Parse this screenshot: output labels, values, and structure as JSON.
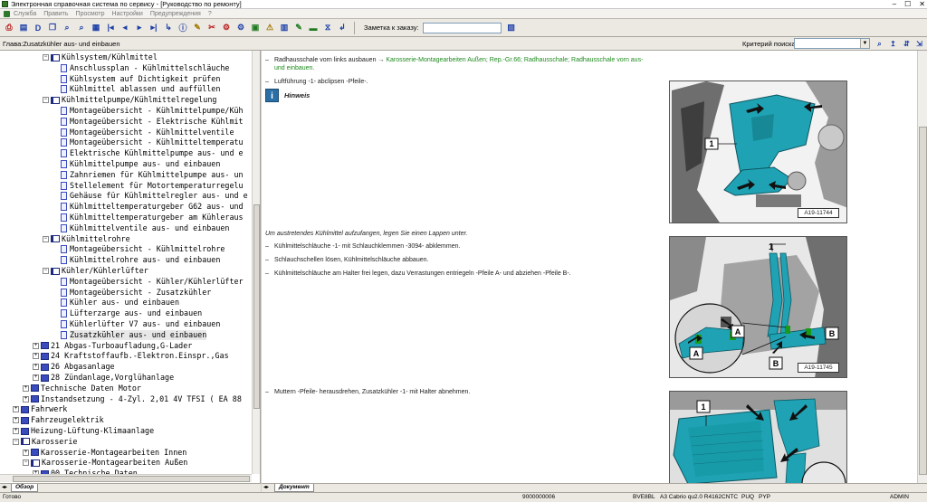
{
  "window": {
    "title": "Электронная справочная система по сервису - [Руководство по ремонту]",
    "controls": [
      "–",
      "☐",
      "✕"
    ]
  },
  "menu": [
    "Служба",
    "Править",
    "Просмотр",
    "Настройки",
    "Предупреждения",
    "?"
  ],
  "toolbar": {
    "buttons": [
      {
        "name": "print-button",
        "glyph": "⎙",
        "cls": "tb-red"
      },
      {
        "name": "open-button",
        "glyph": "▤",
        "cls": "tb-blue"
      },
      {
        "name": "document-button",
        "glyph": "D",
        "cls": "tb-blue"
      },
      {
        "name": "copy-button",
        "glyph": "❐",
        "cls": "tb-blue"
      },
      {
        "name": "find-button",
        "glyph": "⌕",
        "cls": "tb-blue"
      },
      {
        "name": "find-next-button",
        "glyph": "⌕",
        "cls": "tb-blue"
      },
      {
        "name": "notes-button",
        "glyph": "▦",
        "cls": "tb-blue"
      },
      {
        "name": "first-button",
        "glyph": "|◂",
        "cls": "tb-blue"
      },
      {
        "name": "prev-button",
        "glyph": "◂",
        "cls": "tb-blue"
      },
      {
        "name": "next-button",
        "glyph": "▸",
        "cls": "tb-blue"
      },
      {
        "name": "last-button",
        "glyph": "▸|",
        "cls": "tb-blue"
      },
      {
        "name": "bookmark-button",
        "glyph": "↳",
        "cls": "tb-blue"
      },
      {
        "name": "info-button",
        "glyph": "ⓘ",
        "cls": "tb-blue"
      },
      {
        "name": "settings-button",
        "glyph": "✎",
        "cls": "tb-yel"
      },
      {
        "name": "tools-button",
        "glyph": "✂",
        "cls": "tb-red"
      },
      {
        "name": "engine-button",
        "glyph": "⚙",
        "cls": "tb-red"
      },
      {
        "name": "gearbox-button",
        "glyph": "⚙",
        "cls": "tb-blue"
      },
      {
        "name": "body-button",
        "glyph": "▣",
        "cls": "tb-grn"
      },
      {
        "name": "warning-button",
        "glyph": "⚠",
        "cls": "tb-yel"
      },
      {
        "name": "electrics-button",
        "glyph": "▥",
        "cls": "tb-blue"
      },
      {
        "name": "repair-button",
        "glyph": "✎",
        "cls": "tb-grn"
      },
      {
        "name": "vehicle-button",
        "glyph": "▬",
        "cls": "tb-grn"
      },
      {
        "name": "history-button",
        "glyph": "⧖",
        "cls": "tb-blue"
      },
      {
        "name": "arrow-button",
        "glyph": "↲",
        "cls": "tb-blue"
      }
    ],
    "memo_label": "Заметка к заказу:",
    "memo_value": "",
    "memo_icon": "clipboard-icon"
  },
  "chapter": {
    "label": "Глава:Zusatzkühler aus- und einbauen",
    "criteria_label": "Критерий поиска:",
    "criteria_value": ""
  },
  "tree": [
    {
      "indent": 3,
      "kind": "bookopen",
      "exp": "−",
      "label": "Kühlsystem/Kühlmittel",
      "row": 0
    },
    {
      "indent": 4,
      "kind": "doc",
      "label": "Anschlussplan - Kühlmittelschläuche",
      "row": 1
    },
    {
      "indent": 4,
      "kind": "doc",
      "label": "Kühlsystem auf Dichtigkeit prüfen",
      "row": 2
    },
    {
      "indent": 4,
      "kind": "doc",
      "label": "Kühlmittel ablassen und auffüllen",
      "row": 3
    },
    {
      "indent": 3,
      "kind": "bookopen",
      "exp": "−",
      "label": "Kühlmittelpumpe/Kühlmittelregelung",
      "row": 4
    },
    {
      "indent": 4,
      "kind": "doc",
      "label": "Montageübersicht - Kühlmittelpumpe/Küh",
      "row": 5
    },
    {
      "indent": 4,
      "kind": "doc",
      "label": "Montageübersicht - Elektrische Kühlmit",
      "row": 6
    },
    {
      "indent": 4,
      "kind": "doc",
      "label": "Montageübersicht - Kühlmittelventile",
      "row": 7
    },
    {
      "indent": 4,
      "kind": "doc",
      "label": "Montageübersicht - Kühlmitteltemperatu",
      "row": 8
    },
    {
      "indent": 4,
      "kind": "doc",
      "label": "Elektrische Kühlmittelpumpe aus- und e",
      "row": 9
    },
    {
      "indent": 4,
      "kind": "doc",
      "label": "Kühlmittelpumpe aus- und einbauen",
      "row": 10
    },
    {
      "indent": 4,
      "kind": "doc",
      "label": "Zahnriemen für Kühlmittelpumpe aus- un",
      "row": 11
    },
    {
      "indent": 4,
      "kind": "doc",
      "label": "Stellelement für Motortemperaturregelu",
      "row": 12
    },
    {
      "indent": 4,
      "kind": "doc",
      "label": "Gehäuse für Kühlmittelregler aus- und e",
      "row": 13
    },
    {
      "indent": 4,
      "kind": "doc",
      "label": "Kühlmitteltemperaturgeber G62 aus- und",
      "row": 14
    },
    {
      "indent": 4,
      "kind": "doc",
      "label": "Kühlmitteltemperaturgeber am Kühleraus",
      "row": 15
    },
    {
      "indent": 4,
      "kind": "doc",
      "label": "Kühlmittelventile aus- und einbauen",
      "row": 16
    },
    {
      "indent": 3,
      "kind": "bookopen",
      "exp": "−",
      "label": "Kühlmittelrohre",
      "row": 17
    },
    {
      "indent": 4,
      "kind": "doc",
      "label": "Montageübersicht - Kühlmittelrohre",
      "row": 18
    },
    {
      "indent": 4,
      "kind": "doc",
      "label": "Kühlmittelrohre aus- und einbauen",
      "row": 19
    },
    {
      "indent": 3,
      "kind": "bookopen",
      "exp": "−",
      "label": "Kühler/Kühlerlüfter",
      "row": 20
    },
    {
      "indent": 4,
      "kind": "doc",
      "label": "Montageübersicht - Kühler/Kühlerlüfter",
      "row": 21
    },
    {
      "indent": 4,
      "kind": "doc",
      "label": "Montageübersicht - Zusatzkühler",
      "row": 22
    },
    {
      "indent": 4,
      "kind": "doc",
      "label": "Kühler aus- und einbauen",
      "row": 23
    },
    {
      "indent": 4,
      "kind": "doc",
      "label": "Lüfterzarge aus- und einbauen",
      "row": 24
    },
    {
      "indent": 4,
      "kind": "doc",
      "label": "Kühlerlüfter V7 aus- und einbauen",
      "row": 25
    },
    {
      "indent": 4,
      "kind": "doc",
      "label": "Zusatzkühler aus- und einbauen",
      "row": 26,
      "selected": true
    },
    {
      "indent": 2,
      "kind": "book",
      "exp": "+",
      "label": "21 Abgas-Turboaufladung,G-Lader",
      "row": 27
    },
    {
      "indent": 2,
      "kind": "book",
      "exp": "+",
      "label": "24 Kraftstoffaufb.-Elektron.Einspr.,Gas",
      "row": 28
    },
    {
      "indent": 2,
      "kind": "book",
      "exp": "+",
      "label": "26 Abgasanlage",
      "row": 29
    },
    {
      "indent": 2,
      "kind": "book",
      "exp": "+",
      "label": "28 Zündanlage,Vorglühanlage",
      "row": 30
    },
    {
      "indent": 1,
      "kind": "book",
      "exp": "+",
      "label": "Technische Daten Motor",
      "row": 31
    },
    {
      "indent": 1,
      "kind": "book",
      "exp": "+",
      "label": "Instandsetzung - 4-Zyl. 2,01 4V TFSI ( EA 88",
      "row": 32
    },
    {
      "indent": 0,
      "kind": "book",
      "exp": "+",
      "label": "Fahrwerk",
      "row": 33
    },
    {
      "indent": 0,
      "kind": "book",
      "exp": "+",
      "label": "Fahrzeugelektrik",
      "row": 34
    },
    {
      "indent": 0,
      "kind": "book",
      "exp": "+",
      "label": "Heizung-Lüftung-Klimaanlage",
      "row": 35
    },
    {
      "indent": 0,
      "kind": "bookopen",
      "exp": "−",
      "label": "Karosserie",
      "row": 36
    },
    {
      "indent": 1,
      "kind": "book",
      "exp": "+",
      "label": "Karosserie-Montagearbeiten Innen",
      "row": 37
    },
    {
      "indent": 1,
      "kind": "bookopen",
      "exp": "−",
      "label": "Karosserie-Montagearbeiten Außen",
      "row": 38
    },
    {
      "indent": 2,
      "kind": "book",
      "exp": "+",
      "label": "00 Technische Daten",
      "row": 39
    }
  ],
  "document": {
    "step1_text": "Radhausschale vorn links ausbauen → ",
    "step1_link": "Karosserie-Montagearbeiten Außen; Rep.-Gr.66; Radhausschale; Radhausschale vorn aus-",
    "step1_link2": "und einbauen.",
    "step2": "Luftführung -1- abclipsen -Pfeile-.",
    "hinweis": "Hinweis",
    "note": "Um austretendes Kühlmittel aufzufangen, legen Sie einen Lappen unter.",
    "step3": "Kühlmittelschläuche -1- mit Schlauchklemmen -3094- abklemmen.",
    "step4": "Schlauchschellen lösen, Kühlmittelschläuche abbauen.",
    "step5": "Kühlmittelschläuche am Halter frei legen, dazu Verrastungen entriegeln -Pfeile A- und abziehen -Pfeile B-.",
    "step6": "Muttern -Pfeile- herausdrehen, Zusatzkühler -1- mit Halter abnehmen.",
    "fig1_label": "A19-11744",
    "fig2_label": "A19-11745",
    "fig1_callouts": [
      "1"
    ],
    "fig2_callouts": [
      "1",
      "A",
      "A",
      "B",
      "B"
    ],
    "fig3_callouts": [
      "1"
    ]
  },
  "tabs": {
    "left": "Обзор",
    "right": "Документ"
  },
  "status": {
    "ready": "Готово",
    "code": "9000000006",
    "engine": "BVE8BL",
    "model": "A3 Cabrio qu2.0 R4162",
    "cntc": "CNTC",
    "puq": "PUQ",
    "pyp": "PYP",
    "user": "ADMIN"
  },
  "colors": {
    "part_teal": "#1fa3b4",
    "link_green": "#1e8a1e",
    "selection_gray": "#e8e8e8"
  }
}
